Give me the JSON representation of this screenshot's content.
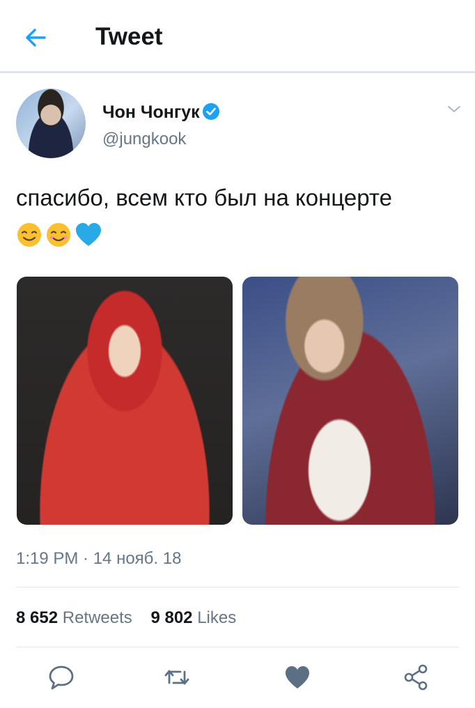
{
  "header": {
    "title": "Tweet",
    "back_icon": "arrow-left-icon",
    "accent": "#1da1f2"
  },
  "tweet": {
    "author_name": "Чон Чонгук",
    "handle": "@jungkook",
    "verified": true,
    "text": "спасибо, всем кто был на концерте",
    "emojis": [
      "smiling-face-icon",
      "smiling-face-icon",
      "blue-heart-icon"
    ],
    "photos": [
      "photo-red-hoodie",
      "photo-microphone"
    ],
    "timestamp": "1:19 PM · 14 нояб. 18"
  },
  "stats": {
    "retweets_count": "8 652",
    "retweets_label": "Retweets",
    "likes_count": "9 802",
    "likes_label": "Likes"
  },
  "actions": [
    "reply-icon",
    "retweet-icon",
    "like-icon",
    "share-icon"
  ],
  "colors": {
    "text": "#14171a",
    "muted": "#657786",
    "verified": "#1da1f2",
    "divider": "#e1e8ed"
  }
}
